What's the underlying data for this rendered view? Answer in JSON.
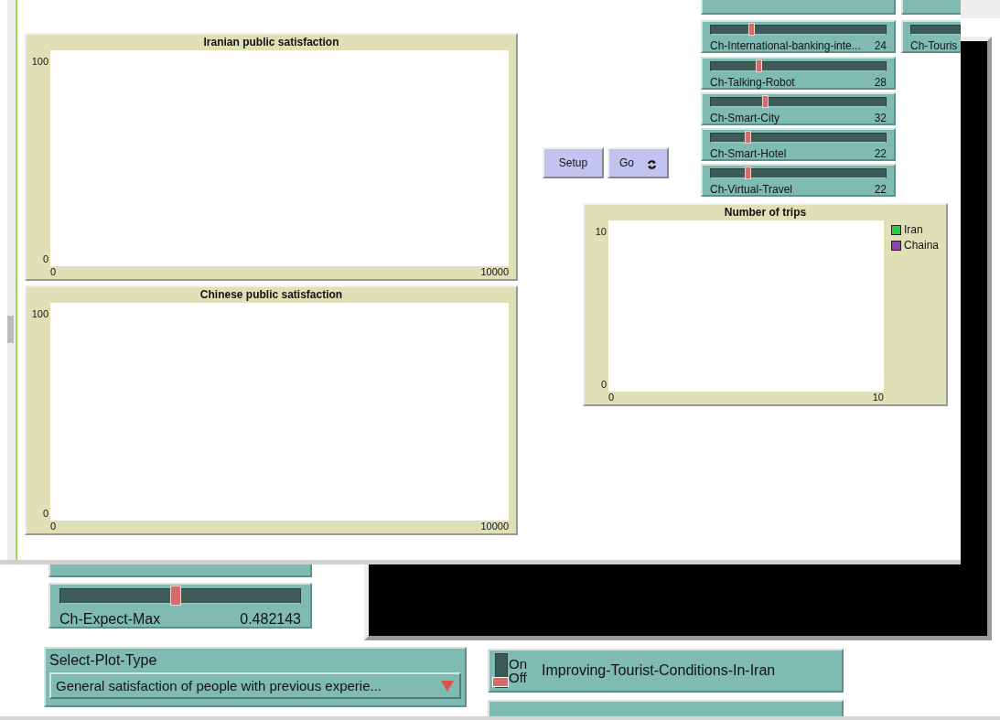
{
  "top_window": {
    "plots": [
      {
        "title": "Iranian public satisfaction",
        "y_max": "100",
        "y_min": "0",
        "x_min": "0",
        "x_max": "10000"
      },
      {
        "title": "Chinese public satisfaction",
        "y_max": "100",
        "y_min": "0",
        "x_min": "0",
        "x_max": "10000"
      },
      {
        "title": "Number of trips",
        "y_max": "10",
        "y_min": "0",
        "x_min": "0",
        "x_max": "10",
        "legend": [
          {
            "name": "Iran",
            "color": "#2ecc40"
          },
          {
            "name": "Chaina",
            "color": "#8e44ad"
          }
        ]
      }
    ],
    "buttons": [
      {
        "label": "Setup",
        "kind": "once"
      },
      {
        "label": "Go",
        "kind": "forever"
      }
    ],
    "sliders": [
      {
        "label": "Ch-International-banking-inte...",
        "value": "24",
        "level": 0.23
      },
      {
        "label": "Ch-Talking-Robot",
        "value": "28",
        "level": 0.27
      },
      {
        "label": "Ch-Smart-City",
        "value": "32",
        "level": 0.31
      },
      {
        "label": "Ch-Smart-Hotel",
        "value": "22",
        "level": 0.21
      },
      {
        "label": "Ch-Virtual-Travel",
        "value": "22",
        "level": 0.21
      }
    ],
    "cut_slider": {
      "label": "Ch-Touris"
    }
  },
  "lower_window": {
    "slider": {
      "label": "Ch-Expect-Max",
      "value": "0.482143",
      "level": 0.48
    },
    "chooser": {
      "label": "Select-Plot-Type",
      "value": "General satisfaction of people with previous experie..."
    },
    "switches": [
      {
        "label": "Improving-Tourist-Conditions-In-Iran",
        "on": false,
        "on_text": "On",
        "off_text": "Off"
      }
    ]
  }
}
